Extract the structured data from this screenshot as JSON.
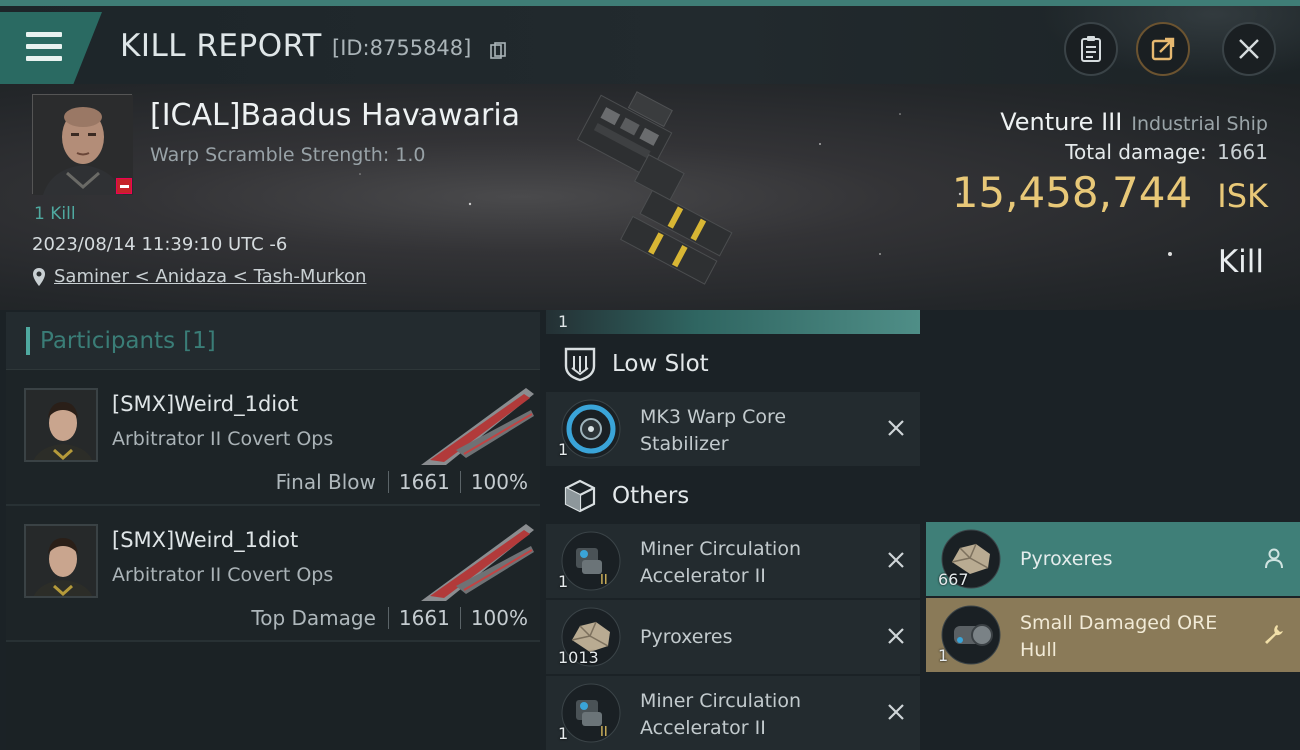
{
  "header": {
    "title": "KILL REPORT",
    "report_id": "[ID:8755848]",
    "buttons": {
      "menu": "menu-icon",
      "clipboard": "clipboard-icon",
      "share": "share-icon",
      "close": "close-icon"
    }
  },
  "victim": {
    "name": "[ICAL]Baadus Havawaria",
    "warp_scramble": "Warp Scramble Strength: 1.0",
    "kill_count": "1 Kill",
    "timestamp": "2023/08/14 11:39:10 UTC -6",
    "location": "Saminer < Anidaza < Tash-Murkon",
    "ship_name": "Venture III",
    "ship_class": "Industrial Ship",
    "total_damage_label": "Total damage:",
    "total_damage": "1661",
    "isk_value": "15,458,744",
    "isk_unit": "ISK",
    "result": "Kill"
  },
  "participants": {
    "title": "Participants",
    "count": "[1]",
    "attackers": [
      {
        "name": "[SMX]Weird_1diot",
        "ship": "Arbitrator II Covert Ops",
        "role": "Final Blow",
        "damage": "1661",
        "percent": "100%"
      },
      {
        "name": "[SMX]Weird_1diot",
        "ship": "Arbitrator II Covert Ops",
        "role": "Top Damage",
        "damage": "1661",
        "percent": "100%"
      }
    ]
  },
  "items": {
    "top_strip_qty": "1",
    "low_slot": {
      "title": "Low Slot",
      "rows": [
        {
          "name": "MK3 Warp Core Stabilizer",
          "qty": "1"
        }
      ]
    },
    "others": {
      "title": "Others",
      "rows": [
        {
          "name": "Miner Circulation Accelerator II",
          "qty": "1"
        },
        {
          "name": "Pyroxeres",
          "qty": "1013"
        },
        {
          "name": "Miner Circulation Accelerator II",
          "qty": "1"
        }
      ]
    },
    "right": [
      {
        "name": "Pyroxeres",
        "qty": "667",
        "status": "dropped",
        "color": "#3f7f78"
      },
      {
        "name": "Small Damaged ORE Hull",
        "qty": "1",
        "status": "salvage",
        "color": "#8a7a58"
      }
    ]
  },
  "colors": {
    "accent": "#4fa9a0",
    "isk": "#e8c878",
    "danger": "#c6242a"
  }
}
